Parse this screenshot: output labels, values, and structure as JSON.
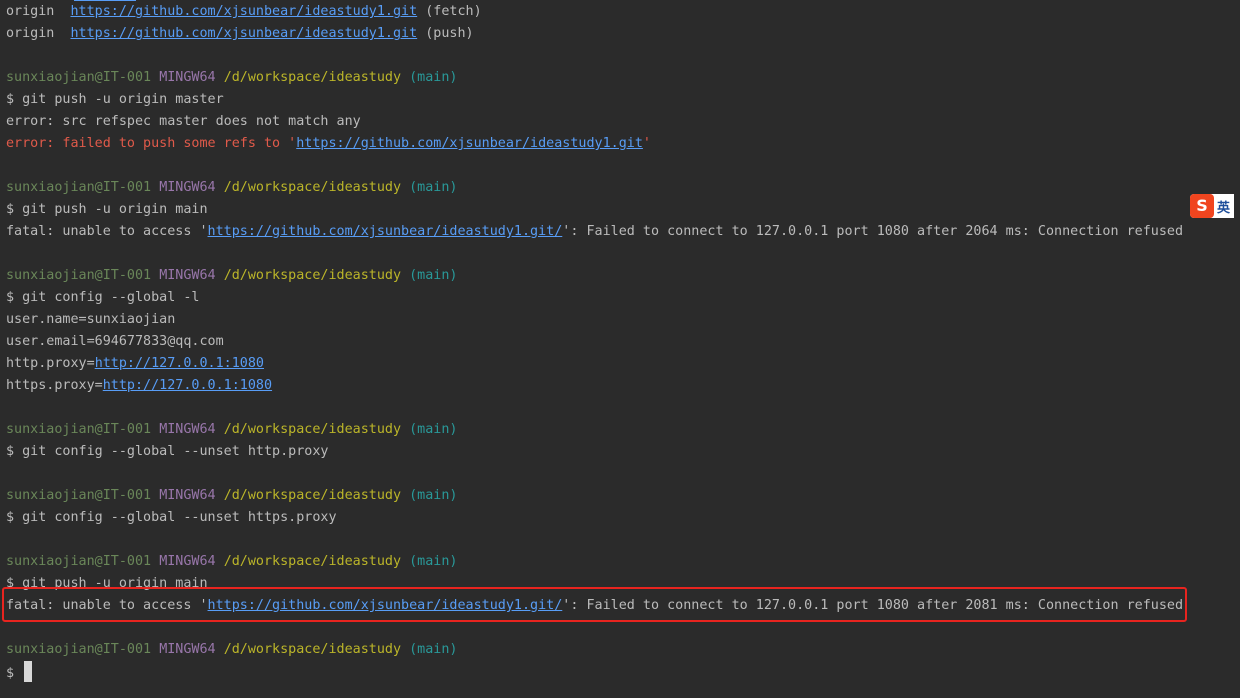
{
  "prompt": {
    "user": "sunxiaojian@IT-001",
    "env": "MINGW64",
    "path": "/d/workspace/ideastudy",
    "branch": "(main)"
  },
  "remote": {
    "name": "origin",
    "url": "https://github.com/xjsunbear/ideastudy1.git",
    "fetch_suffix": "(fetch)",
    "push_suffix": "(push)"
  },
  "cmds": {
    "push_master": "$ git push -u origin master",
    "push_main": "$ git push -u origin main",
    "config_list": "$ git config --global -l",
    "unset_http": "$ git config --global --unset http.proxy",
    "unset_https": "$ git config --global --unset https.proxy",
    "prompt_symbol": "$ "
  },
  "output": {
    "refspec_error": "error: src refspec master does not match any",
    "push_fail_prefix": "error: failed to push some refs to '",
    "push_fail_url": "https://github.com/xjsunbear/ideastudy1.git",
    "push_fail_suffix": "'",
    "fatal_prefix": "fatal: unable to access '",
    "fatal_url": "https://github.com/xjsunbear/ideastudy1.git/",
    "fatal1_suffix": "': Failed to connect to 127.0.0.1 port 1080 after 2064 ms: Connection refused",
    "fatal2_suffix": "': Failed to connect to 127.0.0.1 port 1080 after 2081 ms: Connection refused",
    "user_name": "user.name=sunxiaojian",
    "user_email": "user.email=694677833@qq.com",
    "http_proxy_key": "http.proxy=",
    "https_proxy_key": "https.proxy=",
    "proxy_url": "http://127.0.0.1:1080"
  },
  "ime": {
    "logo": "S",
    "mode": "英"
  },
  "colors": {
    "background": "#2b2b2b",
    "highlight_box": "#e8241f",
    "link": "#589df6",
    "error": "#e05a4a"
  }
}
